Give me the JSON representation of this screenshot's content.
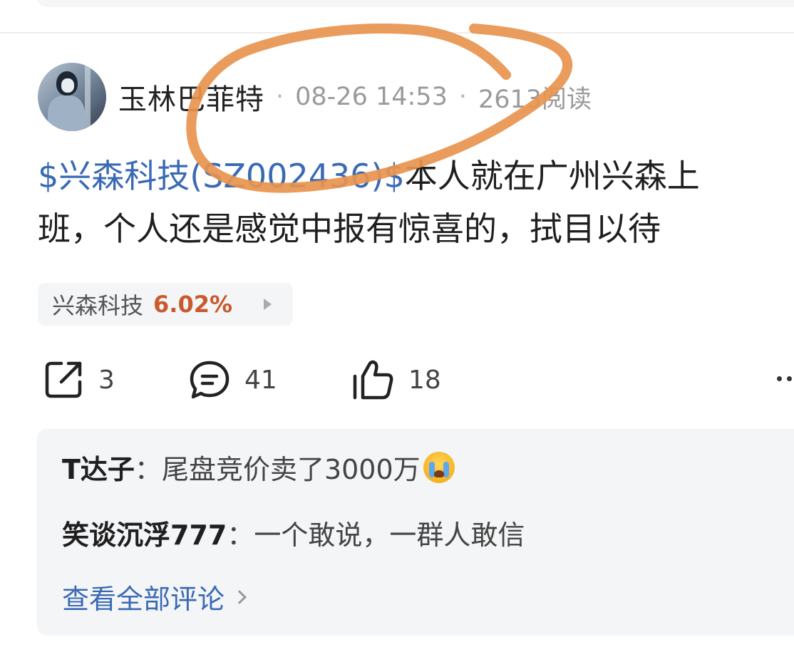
{
  "post": {
    "author": "玉林巴菲特",
    "time": "08-26 14:53",
    "reads": "2613阅读",
    "stock_link": "$兴森科技(SZ002436)$",
    "text_line1": "本人就在广州兴森上",
    "text_line2": "班，个人还是感觉中报有惊喜的，拭目以待"
  },
  "stock_chip": {
    "name": "兴森科技",
    "change": "6.02%"
  },
  "actions": {
    "share_count": "3",
    "comment_count": "41",
    "like_count": "18"
  },
  "comments": [
    {
      "user": "T达子",
      "sep": "：",
      "text": "尾盘竞价卖了3000万"
    },
    {
      "user": "笑谈沉浮777",
      "sep": "：",
      "text": "一个敢说，一群人敢信"
    }
  ],
  "view_all_label": "查看全部评论",
  "colors": {
    "link_blue": "#3a6ab4",
    "rise_orange": "#c85a2d",
    "annotation": "#e8944e"
  },
  "icons": [
    "share-icon",
    "comment-icon",
    "like-icon",
    "more-icon",
    "chevron-right-icon",
    "crying-emoji-icon"
  ]
}
